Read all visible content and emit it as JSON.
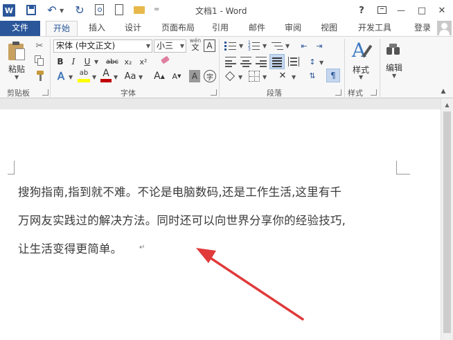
{
  "window": {
    "title": "文档1 - Word",
    "help": "?",
    "minimize": "—",
    "maximize": "□",
    "close": "✕"
  },
  "quick_access": {
    "word_logo": "W",
    "separator": "="
  },
  "tabs": {
    "file": "文件",
    "items": [
      "开始",
      "插入",
      "设计",
      "页面布局",
      "引用",
      "邮件",
      "审阅",
      "视图",
      "开发工具"
    ],
    "active": "开始",
    "login": "登录"
  },
  "ribbon": {
    "clipboard": {
      "paste_label": "粘贴",
      "group_label": "剪贴板"
    },
    "font": {
      "font_name": "宋体 (中文正文)",
      "font_size": "小三",
      "phonetic_top": "wén",
      "phonetic_bottom": "文",
      "char_border": "A",
      "bold": "B",
      "italic": "I",
      "underline": "U",
      "strikethrough": "abc",
      "subscript": "x₂",
      "superscript": "x²",
      "text_effects": "A",
      "highlight": "ab",
      "font_color": "A",
      "change_case": "Aa",
      "grow_font": "A",
      "shrink_font": "A",
      "char_shading": "A",
      "enclose_char": "字",
      "group_label": "字体"
    },
    "paragraph": {
      "group_label": "段落"
    },
    "styles": {
      "label": "样式",
      "group_label": "样式"
    },
    "editing": {
      "label": "编辑"
    }
  },
  "document": {
    "lines": [
      "搜狗指南,指到就不难。不论是电脑数码,还是工作生活,这里有千",
      "万网友实践过的解决方法。同时还可以向世界分享你的经验技巧,",
      "让生活变得更简单。"
    ],
    "paragraph_mark": "↵"
  },
  "colors": {
    "file_tab": "#2b579a",
    "accent_blue": "#2b579a",
    "arrow_red": "#e03a3a",
    "highlight_yellow": "#ffff00",
    "font_color_red": "#c00000"
  }
}
